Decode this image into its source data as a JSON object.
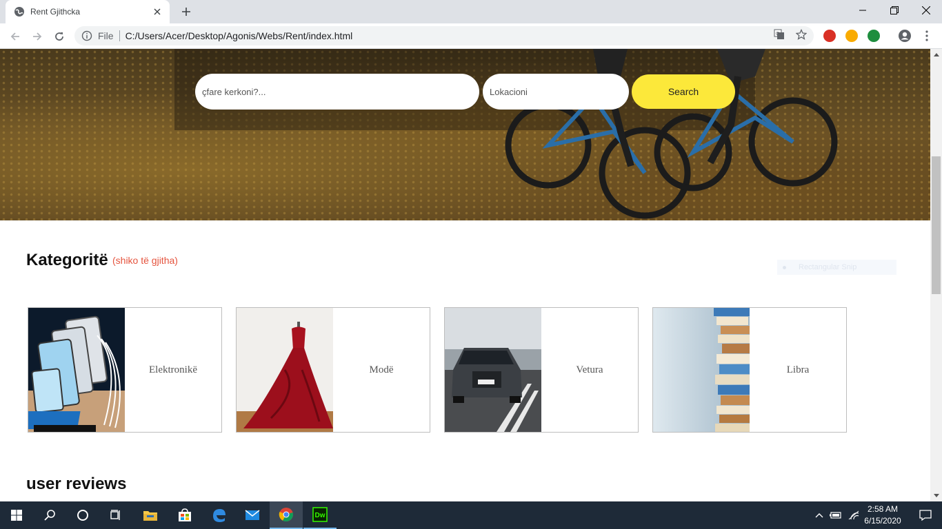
{
  "browser": {
    "tab_title": "Rent Gjithcka",
    "scheme_label": "File",
    "url": "C:/Users/Acer/Desktop/Agonis/Webs/Rent/index.html"
  },
  "hero": {
    "search_placeholder": "çfare kerkoni?...",
    "location_placeholder": "Lokacioni",
    "search_button": "Search"
  },
  "categories": {
    "title": "Kategoritë",
    "see_all": "(shiko të gjitha)",
    "items": [
      {
        "label": "Elektronikë",
        "icon": "tablet-charging-station-image"
      },
      {
        "label": "Modë",
        "icon": "red-dress-image"
      },
      {
        "label": "Vetura",
        "icon": "suv-car-image"
      },
      {
        "label": "Libra",
        "icon": "book-stack-image"
      }
    ]
  },
  "overlay": {
    "snip_label": "Rectangular Snip"
  },
  "reviews": {
    "title": "user reviews"
  },
  "taskbar": {
    "time": "2:58 AM",
    "date": "6/15/2020"
  },
  "colors": {
    "accent_yellow": "#fce83a",
    "link_red": "#e5533d",
    "taskbar": "#1e2a38"
  }
}
